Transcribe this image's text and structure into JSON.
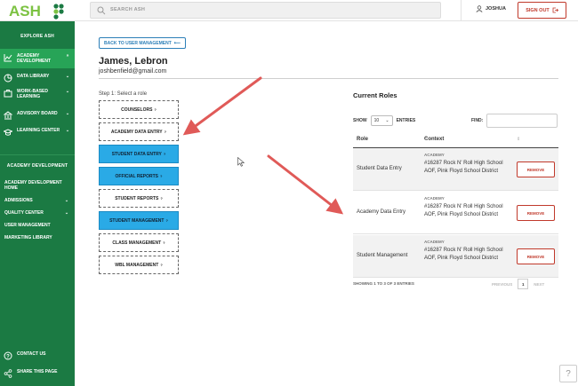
{
  "header": {
    "logo_text": "ASH",
    "search_placeholder": "SEARCH ASH",
    "user_name": "JOSHUA",
    "signout_label": "SIGN OUT"
  },
  "sidebar": {
    "explore_heading": "EXPLORE ASH",
    "items": [
      {
        "label": "ACADEMY DEVELOPMENT",
        "icon": "chart-line-icon",
        "active": true
      },
      {
        "label": "DATA LIBRARY",
        "icon": "pie-chart-icon"
      },
      {
        "label": "WORK-BASED LEARNING",
        "icon": "briefcase-icon"
      },
      {
        "label": "ADVISORY BOARD",
        "icon": "bank-icon"
      },
      {
        "label": "LEARNING CENTER",
        "icon": "graduation-cap-icon"
      }
    ],
    "section_heading": "ACADEMY DEVELOPMENT",
    "sub_items": [
      {
        "label": "ACADEMY DEVELOPMENT HOME"
      },
      {
        "label": "ADMISSIONS",
        "chevron": true
      },
      {
        "label": "QUALITY CENTER",
        "chevron": true
      },
      {
        "label": "USER MANAGEMENT"
      },
      {
        "label": "MARKETING LIBRARY"
      }
    ],
    "contact_label": "CONTACT US",
    "share_label": "SHARE THIS PAGE"
  },
  "main": {
    "back_label": "BACK TO USER MANAGEMENT",
    "user_full_name": "James, Lebron",
    "user_email": "joshbenfield@gmail.com",
    "step_label": "Step 1: Select a role",
    "roles": [
      {
        "label": "COUNSELORS",
        "selected": false
      },
      {
        "label": "ACADEMY DATA ENTRY",
        "selected": false
      },
      {
        "label": "STUDENT DATA ENTRY",
        "selected": true
      },
      {
        "label": "OFFICIAL REPORTS",
        "selected": true
      },
      {
        "label": "STUDENT REPORTS",
        "selected": false
      },
      {
        "label": "STUDENT MANAGEMENT",
        "selected": true
      },
      {
        "label": "CLASS MANAGEMENT",
        "selected": false
      },
      {
        "label": "WBL MANAGEMENT",
        "selected": false
      }
    ],
    "role_help_mark": "?",
    "current_roles_title": "Current Roles",
    "show_label": "SHOW",
    "entries_value": "10",
    "entries_label": "ENTRIES",
    "find_label": "FIND:",
    "table": {
      "headers": [
        "Role",
        "Context"
      ],
      "rows": [
        {
          "role": "Student Data Entry",
          "context_label": "ACADEMY",
          "context": "#16287 Rock N' Roll High School AOF, Pink Floyd School District",
          "action": "REMOVE"
        },
        {
          "role": "Academy Data Entry",
          "context_label": "ACADEMY",
          "context": "#16287 Rock N' Roll High School AOF, Pink Floyd School District",
          "action": "REMOVE"
        },
        {
          "role": "Student Management",
          "context_label": "ACADEMY",
          "context": "#16287 Rock N' Roll High School AOF, Pink Floyd School District",
          "action": "REMOVE"
        }
      ]
    },
    "showing_text": "SHOWING 1 TO 3 OF 3 ENTRIES",
    "pager": {
      "previous": "PREVIOUS",
      "page": "1",
      "next": "NEXT"
    },
    "help_label": "?"
  },
  "colors": {
    "sidebar_green": "#1b7a43",
    "active_green": "#27a457",
    "selected_blue": "#2aaae6",
    "danger_red": "#c0392b",
    "arrow_red": "#e05a58"
  }
}
